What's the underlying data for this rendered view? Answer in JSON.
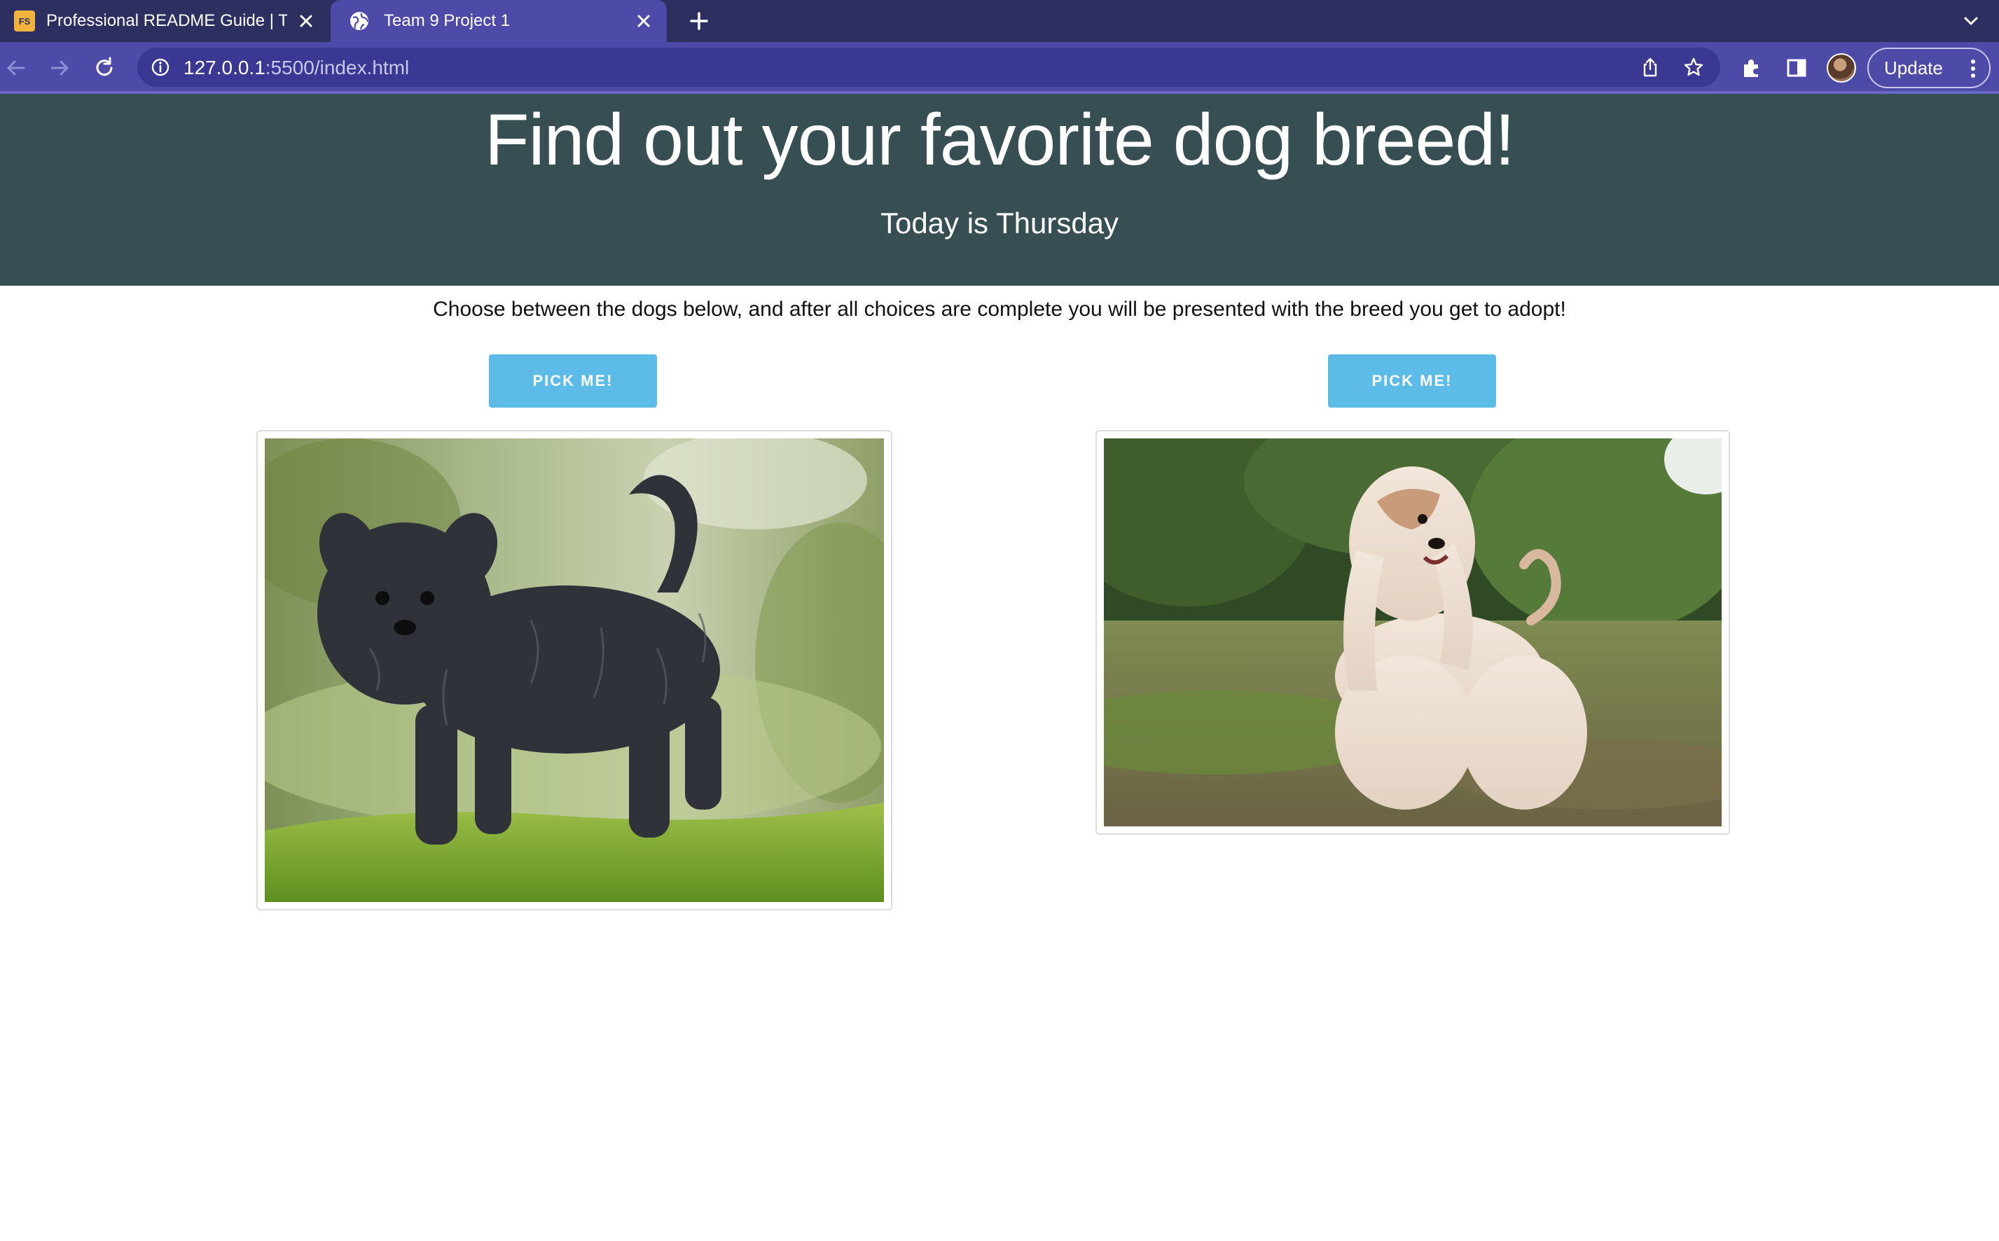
{
  "browser": {
    "tabs": [
      {
        "favicon_text": "FS",
        "title": "Professional README Guide | T",
        "active": false
      },
      {
        "favicon_icon": "globe-icon",
        "title": "Team 9 Project 1",
        "active": true
      }
    ],
    "url_host": "127.0.0.1",
    "url_rest": ":5500/index.html",
    "update_label": "Update"
  },
  "page": {
    "title": "Find out your favorite dog breed!",
    "subtitle": "Today is Thursday",
    "instructions": "Choose between the dogs below, and after all choices are complete you will be presented with the breed you get to adopt!",
    "choices": [
      {
        "button_label": "PICK ME!",
        "image_name": "affenpinscher-photo"
      },
      {
        "button_label": "PICK ME!",
        "image_name": "afghan-hound-photo"
      }
    ]
  },
  "colors": {
    "tabbar": "#2e2f61",
    "toolbar": "#4d4aa8",
    "hero_bg": "#374f53",
    "button_bg": "#5dbbe8"
  }
}
